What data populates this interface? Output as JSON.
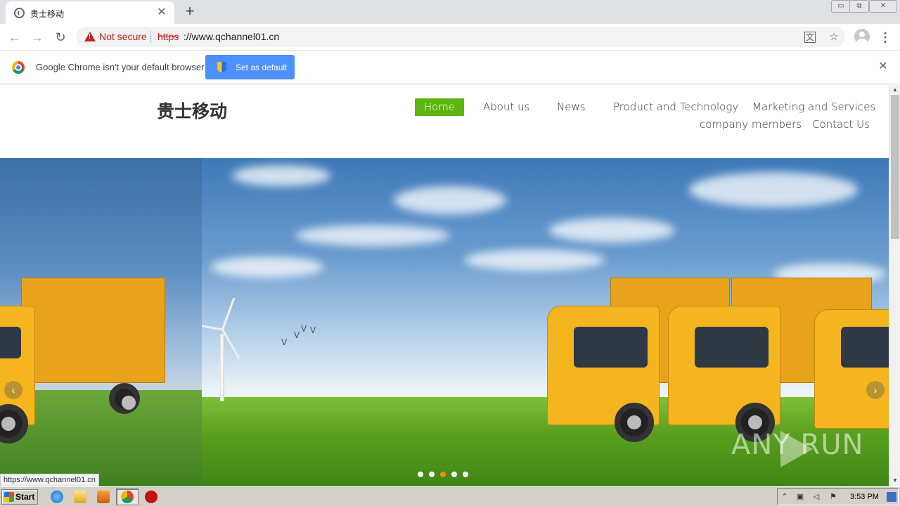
{
  "browser": {
    "tab": {
      "title": "贵士移动",
      "close": "✕"
    },
    "new_tab": "+",
    "window_controls": {
      "minimize": "▭",
      "restore": "⧉",
      "close": "✕"
    },
    "nav": {
      "back": "←",
      "forward": "→",
      "reload": "↻"
    },
    "omnibox": {
      "security_label": "Not secure",
      "url_scheme": "https",
      "url_rest": "://www.qchannel01.cn"
    },
    "icons": {
      "translate": "translate-icon",
      "bookmark": "☆",
      "menu": "⋮"
    }
  },
  "infobar": {
    "message": "Google Chrome isn't your default browser",
    "button_label": "Set as default",
    "close": "✕"
  },
  "site": {
    "logo": "贵士移动",
    "nav": [
      {
        "label": "Home",
        "active": true
      },
      {
        "label": "About us"
      },
      {
        "label": "News"
      },
      {
        "label": "Product and Technology"
      },
      {
        "label": "Marketing and Services"
      },
      {
        "label": "company members"
      },
      {
        "label": "Contact Us"
      }
    ],
    "carousel": {
      "prev": "‹",
      "next": "›",
      "slide_count": 5,
      "active_slide": 3
    },
    "watermark": "ANY RUN",
    "colors": {
      "nav_active": "#5db510",
      "dot_active": "#f08a1d"
    }
  },
  "status_bar_url": "https://www.qchannel01.cn",
  "scrollbar": {
    "up": "▲",
    "down": "▼"
  },
  "taskbar": {
    "start_label": "Start",
    "clock": "3:53 PM"
  }
}
